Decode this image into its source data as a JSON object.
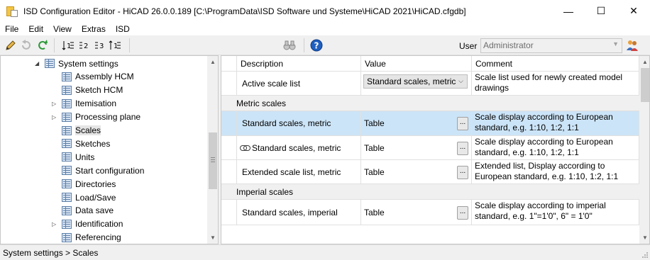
{
  "window": {
    "title": "ISD Configuration Editor  - HiCAD 26.0.0.189 [C:\\ProgramData\\ISD Software und Systeme\\HiCAD 2021\\HiCAD.cfgdb]",
    "minimize": "—",
    "maximize": "☐",
    "close": "✕"
  },
  "menu": [
    "File",
    "Edit",
    "View",
    "Extras",
    "ISD"
  ],
  "toolbar": {
    "icons": [
      "pencil-icon",
      "undo-icon",
      "refresh-icon",
      "sort-1-icon",
      "sort-2-icon",
      "sort-3-icon",
      "sort-4-icon",
      "binoculars-icon",
      "help-icon"
    ],
    "user_label": "User",
    "user_value": "Administrator"
  },
  "tree": {
    "items": [
      {
        "label": "System settings",
        "expander": "◢",
        "level": 0
      },
      {
        "label": "Assembly HCM",
        "expander": "",
        "level": 1
      },
      {
        "label": "Sketch HCM",
        "expander": "",
        "level": 1
      },
      {
        "label": "Itemisation",
        "expander": "▷",
        "level": 1
      },
      {
        "label": "Processing plane",
        "expander": "▷",
        "level": 1
      },
      {
        "label": "Scales",
        "expander": "",
        "level": 1,
        "selected": true
      },
      {
        "label": "Sketches",
        "expander": "",
        "level": 1
      },
      {
        "label": "Units",
        "expander": "",
        "level": 1
      },
      {
        "label": "Start configuration",
        "expander": "",
        "level": 1
      },
      {
        "label": "Directories",
        "expander": "",
        "level": 1
      },
      {
        "label": "Load/Save",
        "expander": "",
        "level": 1
      },
      {
        "label": "Data save",
        "expander": "",
        "level": 1
      },
      {
        "label": "Identification",
        "expander": "▷",
        "level": 1
      },
      {
        "label": "Referencing",
        "expander": "",
        "level": 1
      }
    ]
  },
  "grid": {
    "headers": {
      "description": "Description",
      "value": "Value",
      "comment": "Comment"
    },
    "top_row": {
      "description": "Active scale list",
      "value": "Standard scales, metric",
      "comment": "Scale list used for newly created model drawings"
    },
    "groups": [
      {
        "name": "Metric scales",
        "rows": [
          {
            "description": "Standard scales, metric",
            "value": "Table",
            "button": "...",
            "comment": "Scale display according to European standard, e.g. 1:10, 1:2, 1:1",
            "linked": false
          },
          {
            "description": "Standard scales, metric",
            "value": "Table",
            "button": "...",
            "comment": "Scale display according to European standard, e.g. 1:10, 1:2, 1:1",
            "linked": true
          },
          {
            "description": "Extended scale list, metric",
            "value": "Table",
            "button": "...",
            "comment": "Extended list, Display according to European standard, e.g. 1:10, 1:2, 1:1",
            "linked": false
          }
        ]
      },
      {
        "name": "Imperial scales",
        "rows": [
          {
            "description": "Standard scales, imperial",
            "value": "Table",
            "button": "...",
            "comment": "Scale display according to imperial standard, e.g. 1\"=1'0\", 6\" = 1'0\"",
            "linked": false
          }
        ]
      }
    ]
  },
  "status": {
    "path": "System settings > Scales"
  },
  "colors": {
    "highlight": "#cce4f7",
    "selection": "#e5e5e5"
  }
}
